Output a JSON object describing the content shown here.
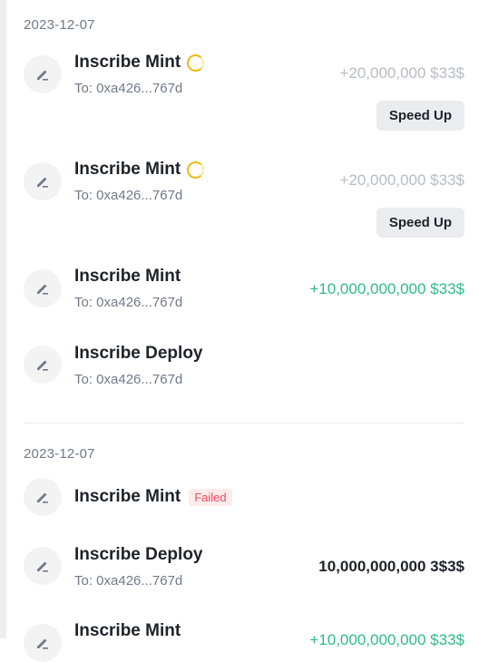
{
  "groups": [
    {
      "date": "2023-12-07",
      "items": [
        {
          "title": "Inscribe Mint",
          "to": "To: 0xa426...767d",
          "amount": "+20,000,000 $33$",
          "action": "Speed Up",
          "status_icon": "pending-spinner-icon"
        },
        {
          "title": "Inscribe Mint",
          "to": "To: 0xa426...767d",
          "amount": "+20,000,000 $33$",
          "action": "Speed Up",
          "status_icon": "pending-spinner-icon"
        },
        {
          "title": "Inscribe Mint",
          "to": "To: 0xa426...767d",
          "amount": "+10,000,000,000 $33$"
        },
        {
          "title": "Inscribe Deploy",
          "to": "To: 0xa426...767d"
        }
      ]
    },
    {
      "date": "2023-12-07",
      "items": [
        {
          "title": "Inscribe Mint",
          "badge": "Failed"
        },
        {
          "title": "Inscribe Deploy",
          "to": "To: 0xa426...767d",
          "amount": "10,000,000,000 3$3$"
        },
        {
          "title": "Inscribe Mint",
          "amount": "+10,000,000,000 $33$"
        }
      ]
    }
  ],
  "icon": "edit-pen-icon",
  "colors": {
    "positive": "#2ebd85",
    "pending": "#b7bdc6",
    "spinner": "#f0b90b",
    "failed": "#f6465d"
  }
}
